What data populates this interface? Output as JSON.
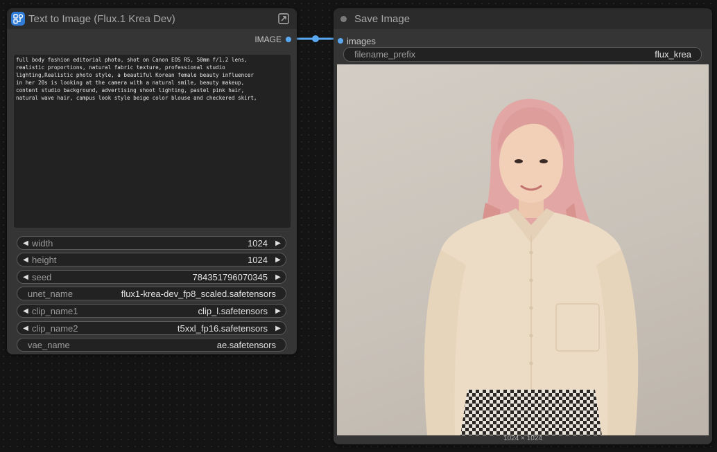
{
  "text_to_image_node": {
    "title": "Text to Image (Flux.1 Krea Dev)",
    "output_label": "IMAGE",
    "prompt": "full body fashion editorial photo, shot on Canon EOS R5, 50mm f/1.2 lens,\nrealistic proportions, natural fabric texture, professional studio\nlighting,Realistic photo style, a beautiful Korean female beauty influencer\nin her 20s is looking at the camera with a natural smile, beauty makeup,\ncontent studio background, advertising shoot lighting, pastel pink hair,\nnatural wave hair, campus look style beige color blouse and checkered skirt,",
    "widgets": {
      "width": {
        "name": "width",
        "value": "1024"
      },
      "height": {
        "name": "height",
        "value": "1024"
      },
      "seed": {
        "name": "seed",
        "value": "784351796070345"
      },
      "unet_name": {
        "name": "unet_name",
        "value": "flux1-krea-dev_fp8_scaled.safetensors"
      },
      "clip_name1": {
        "name": "clip_name1",
        "value": "clip_l.safetensors"
      },
      "clip_name2": {
        "name": "clip_name2",
        "value": "t5xxl_fp16.safetensors"
      },
      "vae_name": {
        "name": "vae_name",
        "value": "ae.safetensors"
      }
    },
    "icons": {
      "app": "workflow-icon",
      "expand": "expand-icon",
      "decrement": "arrow-left-icon",
      "increment": "arrow-right-icon"
    }
  },
  "save_image_node": {
    "title": "Save Image",
    "input_label": "images",
    "filename_prefix": {
      "name": "filename_prefix",
      "value": "flux_krea"
    },
    "image_dimensions": "1024 × 1024"
  },
  "colors": {
    "link": "#5aa9f0",
    "accent": "#2f7bd8",
    "node_bg": "#353535",
    "canvas_bg": "#141414"
  }
}
